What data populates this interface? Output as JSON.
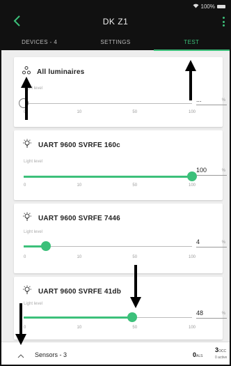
{
  "status": {
    "text": "100%"
  },
  "header": {
    "title": "DK Z1"
  },
  "tabs": [
    {
      "label": "DEVICES - 4",
      "active": false
    },
    {
      "label": "SETTINGS",
      "active": false
    },
    {
      "label": "TEST",
      "active": true
    }
  ],
  "cards": [
    {
      "title": "All luminaires",
      "icon": "group-icon",
      "light_label": "Light level",
      "value": "...",
      "unit": "%",
      "level": null,
      "ticks": [
        "0",
        "10",
        "50",
        "100"
      ]
    },
    {
      "title": "UART 9600 SVRFE 160c",
      "icon": "bulb-icon",
      "light_label": "Light level",
      "value": "100",
      "unit": "%",
      "level": 1.0,
      "ticks": [
        "0",
        "10",
        "50",
        "100"
      ]
    },
    {
      "title": "UART 9600 SVRFE 7446",
      "icon": "bulb-icon",
      "light_label": "Light level",
      "value": "4",
      "unit": "%",
      "level": 0.04,
      "ticks": [
        "0",
        "10",
        "50",
        "100"
      ]
    },
    {
      "title": "UART 9600 SVRFE 41db",
      "icon": "bulb-icon",
      "light_label": "Light level",
      "value": "48",
      "unit": "%",
      "level": 0.48,
      "ticks": [
        "0",
        "10",
        "50",
        "100"
      ]
    }
  ],
  "sensors": {
    "title": "Sensors - 3",
    "als_count": "0",
    "als_unit": "ALS",
    "occ_count": "3",
    "occ_unit": "OCC",
    "occ_sub": "0 active"
  },
  "colors": {
    "accent": "#3cc07a",
    "header_bg": "#111111"
  }
}
